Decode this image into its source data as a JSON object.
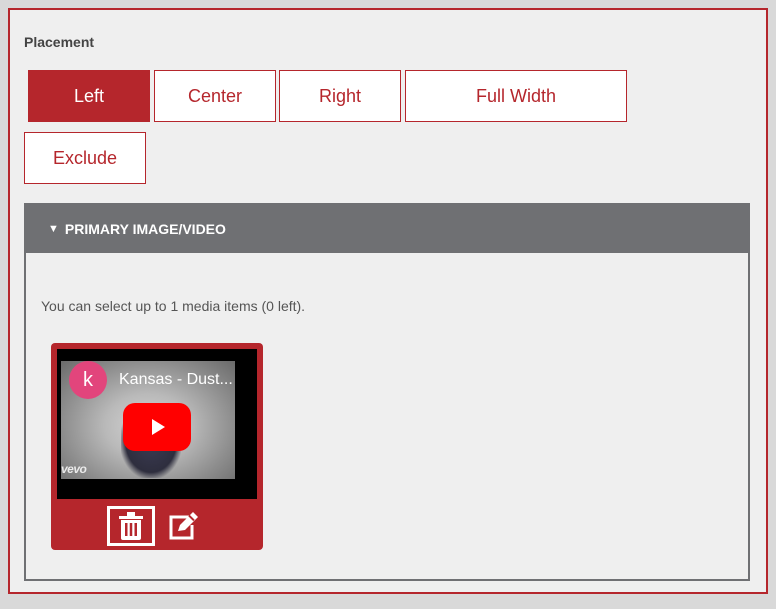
{
  "placement": {
    "label": "Placement",
    "options": [
      {
        "label": "Left",
        "active": true
      },
      {
        "label": "Center",
        "active": false
      },
      {
        "label": "Right",
        "active": false
      },
      {
        "label": "Full Width",
        "active": false
      },
      {
        "label": "Exclude",
        "active": false
      }
    ]
  },
  "primary_media": {
    "header": "PRIMARY IMAGE/VIDEO",
    "info_text": "You can select up to 1 media items (0 left).",
    "item": {
      "avatar_letter": "k",
      "title": "Kansas - Dust...",
      "watermark": "vevo"
    },
    "actions": {
      "delete_icon": "trash-icon",
      "edit_icon": "edit-icon"
    }
  },
  "colors": {
    "accent": "#b5262c",
    "header_bg": "#6f7073",
    "panel_bg": "#efefef",
    "avatar": "#e2457c",
    "play_button": "#ff0000"
  }
}
